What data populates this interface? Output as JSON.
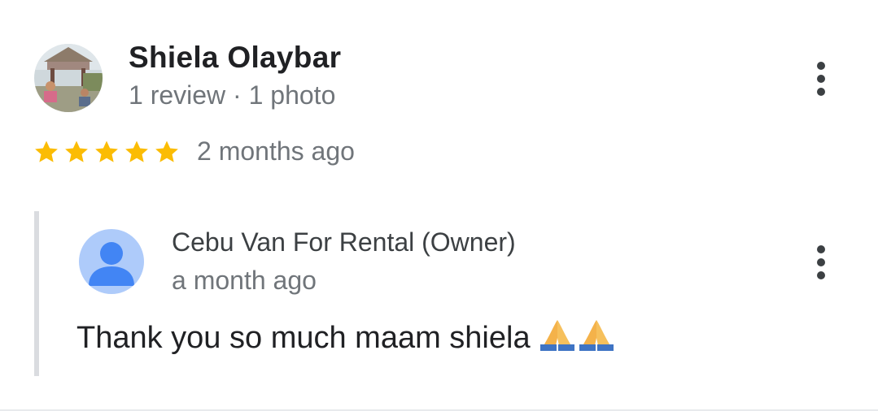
{
  "review": {
    "reviewer_name": "Shiela Olaybar",
    "reviewer_meta": "1 review · 1 photo",
    "rating": 5,
    "date": "2 months ago",
    "star_color": "#fbbc04",
    "avatar_icon": "reviewer-photo-avatar"
  },
  "owner_reply": {
    "owner_name": "Cebu Van For Rental (Owner)",
    "date": "a month ago",
    "text": "Thank you so much maam shiela",
    "emoji": "🙏🙏",
    "avatar_icon": "default-person-avatar"
  },
  "icons": {
    "more": "more-vert-icon",
    "star": "star-icon"
  }
}
